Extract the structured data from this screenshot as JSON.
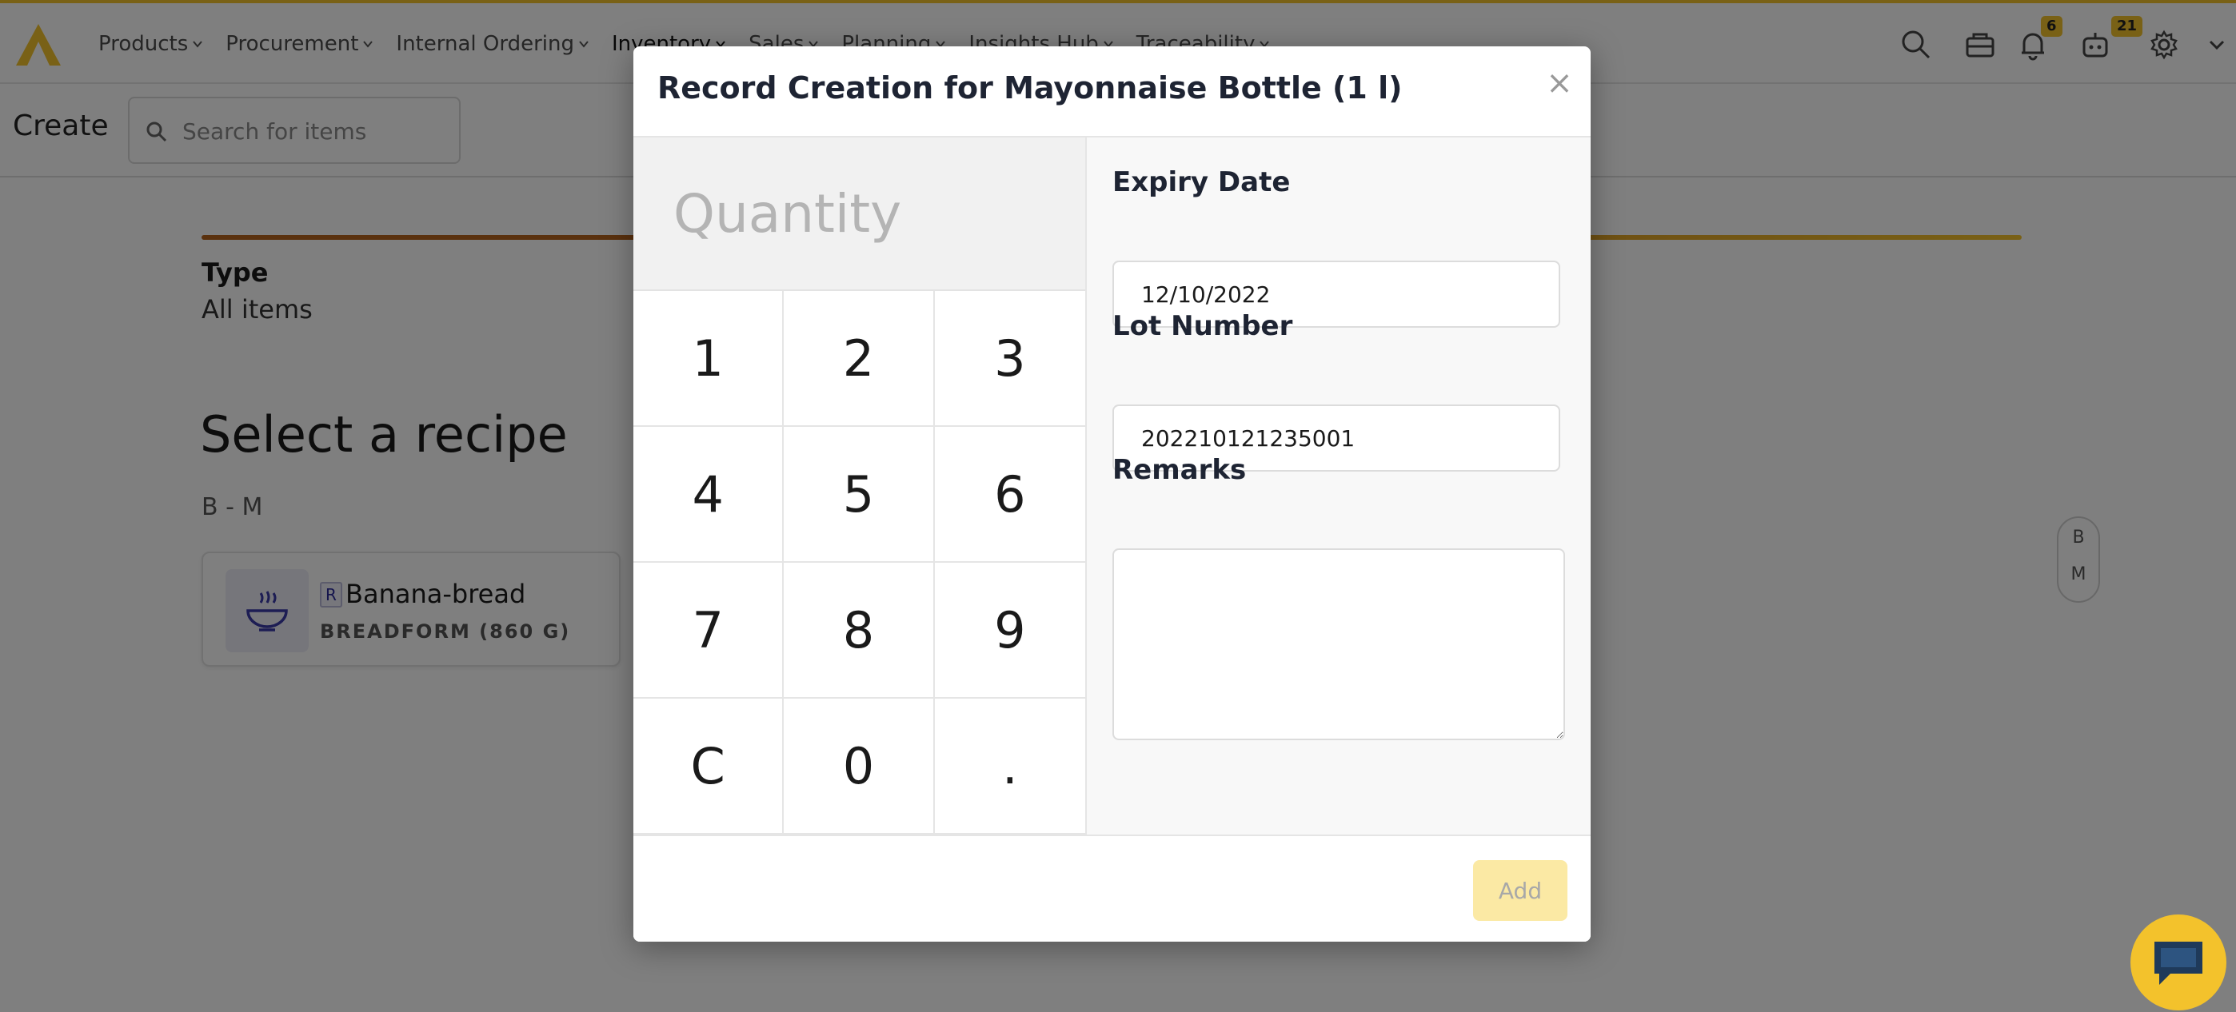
{
  "nav": {
    "items": [
      {
        "label": "Products"
      },
      {
        "label": "Procurement"
      },
      {
        "label": "Internal Ordering"
      },
      {
        "label": "Inventory"
      },
      {
        "label": "Sales"
      },
      {
        "label": "Planning"
      },
      {
        "label": "Insights Hub"
      },
      {
        "label": "Traceability"
      }
    ],
    "active_item": "Inventory",
    "notifications_count": "6",
    "bot_count": "21",
    "brand_color": "#f3c22c"
  },
  "subheader": {
    "title": "Create",
    "search_placeholder": "Search for items"
  },
  "background": {
    "type_label": "Type",
    "type_value": "All items",
    "select_title": "Select a recipe",
    "group_label": "B - M",
    "recipe": {
      "badge": "R",
      "name": "Banana-bread",
      "subtitle": "BREADFORM (860 G)"
    },
    "alphabet": [
      "B",
      "M"
    ]
  },
  "modal": {
    "title": "Record Creation for Mayonnaise Bottle (1 l)",
    "close_label": "×",
    "quantity_placeholder": "Quantity",
    "keypad": [
      "1",
      "2",
      "3",
      "4",
      "5",
      "6",
      "7",
      "8",
      "9",
      "C",
      "0",
      "."
    ],
    "expiry_label": "Expiry Date",
    "expiry_value": "12/10/2022",
    "lot_label": "Lot Number",
    "lot_value": "202210121235001",
    "remarks_label": "Remarks",
    "remarks_value": "",
    "add_label": "Add"
  }
}
